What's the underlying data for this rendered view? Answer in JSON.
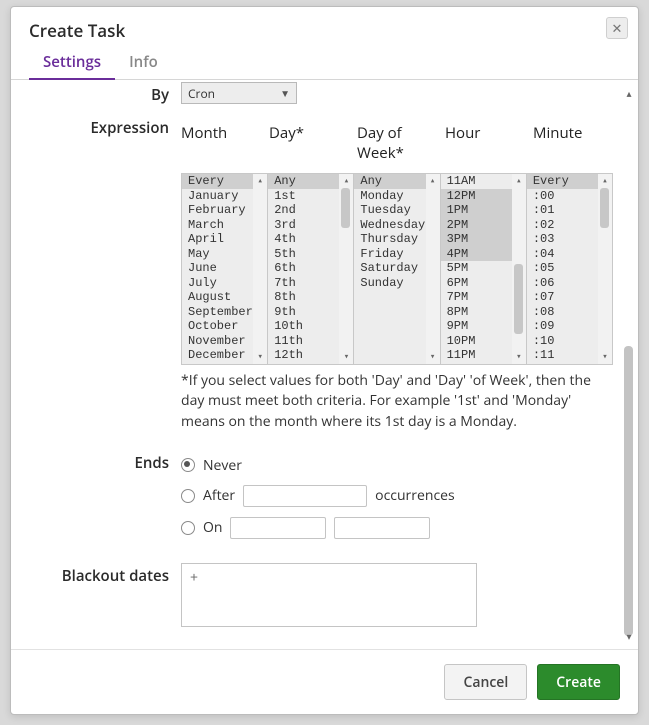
{
  "dialog": {
    "title": "Create Task"
  },
  "tabs": {
    "settings": "Settings",
    "info": "Info",
    "active": "settings"
  },
  "form": {
    "byLabel": "By",
    "bySelected": "Cron",
    "expressionLabel": "Expression",
    "headers": {
      "month": "Month",
      "day": "Day*",
      "dow": "Day of\nWeek*",
      "hour": "Hour",
      "minute": "Minute"
    },
    "lists": {
      "month": {
        "selected": [
          0
        ],
        "items": [
          "Every",
          "January",
          "February",
          "March",
          "April",
          "May",
          "June",
          "July",
          "August",
          "September",
          "October",
          "November",
          "December"
        ]
      },
      "day": {
        "selected": [
          0
        ],
        "items": [
          "Any",
          "1st",
          "2nd",
          "3rd",
          "4th",
          "5th",
          "6th",
          "7th",
          "8th",
          "9th",
          "10th",
          "11th",
          "12th"
        ]
      },
      "dow": {
        "selected": [
          0
        ],
        "items": [
          "Any",
          "Monday",
          "Tuesday",
          "Wednesday",
          "Thursday",
          "Friday",
          "Saturday",
          "Sunday"
        ]
      },
      "hour": {
        "selected": [
          1,
          2,
          3,
          4,
          5
        ],
        "items": [
          "11AM",
          "12PM",
          "1PM",
          "2PM",
          "3PM",
          "4PM",
          "5PM",
          "6PM",
          "7PM",
          "8PM",
          "9PM",
          "10PM",
          "11PM"
        ],
        "thumbTop": 90,
        "thumbH": 70
      },
      "minute": {
        "selected": [
          0
        ],
        "items": [
          "Every",
          ":00",
          ":01",
          ":02",
          ":03",
          ":04",
          ":05",
          ":06",
          ":07",
          ":08",
          ":09",
          ":10",
          ":11"
        ],
        "thumbTop": 14,
        "thumbH": 40
      }
    },
    "note": "*If you select values for both 'Day' and 'Day' 'of Week', then the day must meet both criteria. For example '1st' and 'Monday' means on the month where its 1st day is a Monday.",
    "endsLabel": "Ends",
    "ends": {
      "never": "Never",
      "afterPrefix": "After",
      "afterSuffix": "occurrences",
      "on": "On",
      "selected": "never"
    },
    "blackoutLabel": "Blackout dates",
    "blackoutPlaceholder": "+"
  },
  "footer": {
    "cancel": "Cancel",
    "create": "Create"
  }
}
